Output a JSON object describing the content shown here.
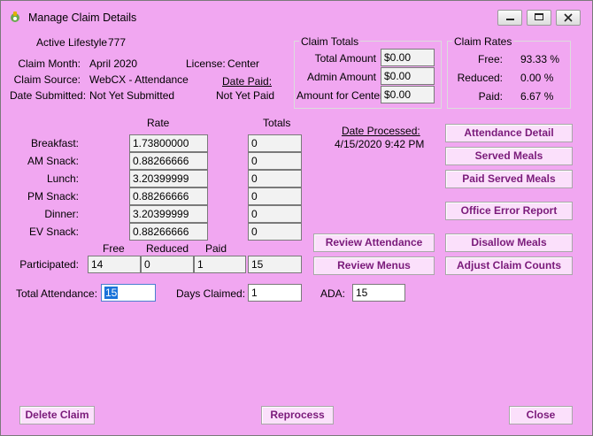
{
  "window": {
    "title": "Manage Claim Details"
  },
  "header": {
    "org_label": "Active Lifestyle",
    "org_id": "777",
    "claim_month_label": "Claim Month:",
    "claim_month": "April 2020",
    "license_label": "License:",
    "license": "Center",
    "claim_source_label": "Claim Source:",
    "claim_source": "WebCX - Attendance",
    "date_paid_label": "Date Paid:",
    "date_submitted_label": "Date Submitted:",
    "date_submitted": "Not Yet Submitted",
    "date_paid": "Not Yet Paid"
  },
  "claim_totals": {
    "title": "Claim Totals",
    "total_amount_label": "Total Amount",
    "total_amount": "$0.00",
    "admin_amount_label": "Admin Amount",
    "admin_amount": "$0.00",
    "amount_center_label": "Amount for Center",
    "amount_center": "$0.00"
  },
  "claim_rates": {
    "title": "Claim Rates",
    "free_label": "Free:",
    "free": "93.33 %",
    "reduced_label": "Reduced:",
    "reduced": "0.00 %",
    "paid_label": "Paid:",
    "paid": "6.67 %"
  },
  "meals": {
    "rate_header": "Rate",
    "totals_header": "Totals",
    "rows": [
      {
        "label": "Breakfast:",
        "rate": "1.73800000",
        "total": "0"
      },
      {
        "label": "AM Snack:",
        "rate": "0.88266666",
        "total": "0"
      },
      {
        "label": "Lunch:",
        "rate": "3.20399999",
        "total": "0"
      },
      {
        "label": "PM Snack:",
        "rate": "0.88266666",
        "total": "0"
      },
      {
        "label": "Dinner:",
        "rate": "3.20399999",
        "total": "0"
      },
      {
        "label": "EV Snack:",
        "rate": "0.88266666",
        "total": "0"
      }
    ]
  },
  "participation": {
    "free_header": "Free",
    "reduced_header": "Reduced",
    "paid_header": "Paid",
    "label": "Participated:",
    "free": "14",
    "reduced": "0",
    "paid": "1",
    "total": "15"
  },
  "processed": {
    "label": "Date Processed:",
    "value": "4/15/2020 9:42 PM"
  },
  "attendance": {
    "total_label": "Total Attendance:",
    "total": "15",
    "days_label": "Days Claimed:",
    "days": "1",
    "ada_label": "ADA:",
    "ada": "15"
  },
  "buttons": {
    "attendance_detail": "Attendance Detail",
    "served_meals": "Served Meals",
    "paid_served_meals": "Paid Served Meals",
    "office_error_report": "Office Error Report",
    "review_attendance": "Review Attendance",
    "disallow_meals": "Disallow Meals",
    "review_menus": "Review Menus",
    "adjust_claim_counts": "Adjust Claim Counts",
    "delete_claim": "Delete Claim",
    "reprocess": "Reprocess",
    "close": "Close"
  }
}
